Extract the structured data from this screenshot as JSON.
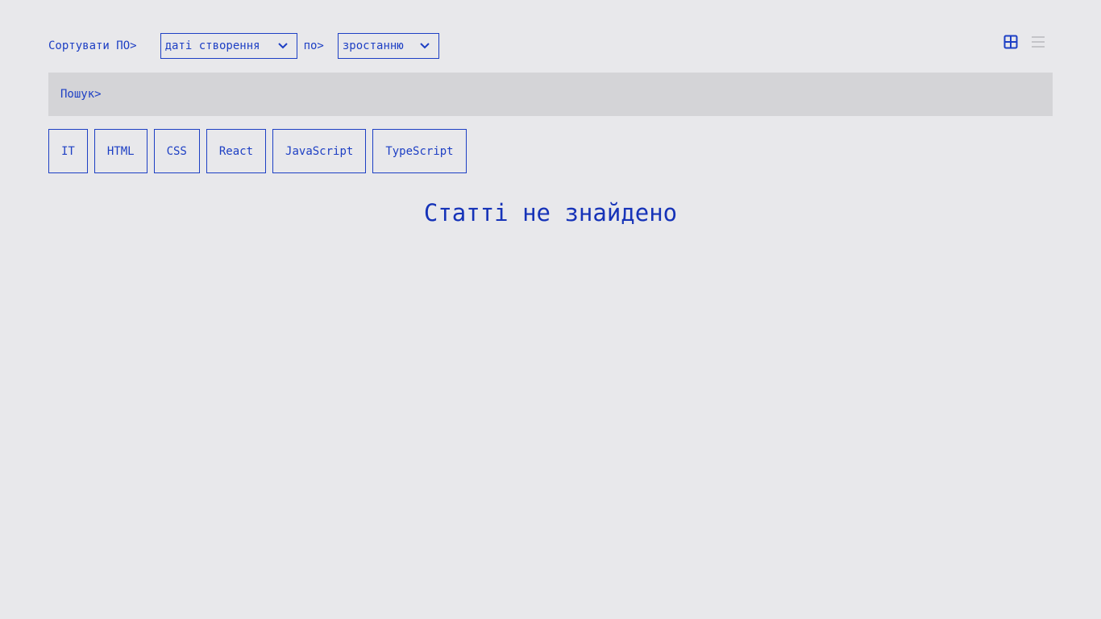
{
  "sort": {
    "label": "Сортувати ПО>",
    "field_value": "даті створення",
    "by_label": "по>",
    "order_value": "зростанню"
  },
  "view_toggle": {
    "grid_icon": "grid-icon",
    "list_icon": "list-icon",
    "active": "grid"
  },
  "search": {
    "label": "Пошук>",
    "value": "",
    "placeholder": ""
  },
  "tags": [
    "IT",
    "HTML",
    "CSS",
    "React",
    "JavaScript",
    "TypeScript"
  ],
  "empty_message": "Статті не знайдено",
  "colors": {
    "accent": "#1d3fc4",
    "background": "#e8e8eb",
    "search_bg": "#d4d4d7",
    "inactive_icon": "#c4c4c8"
  }
}
